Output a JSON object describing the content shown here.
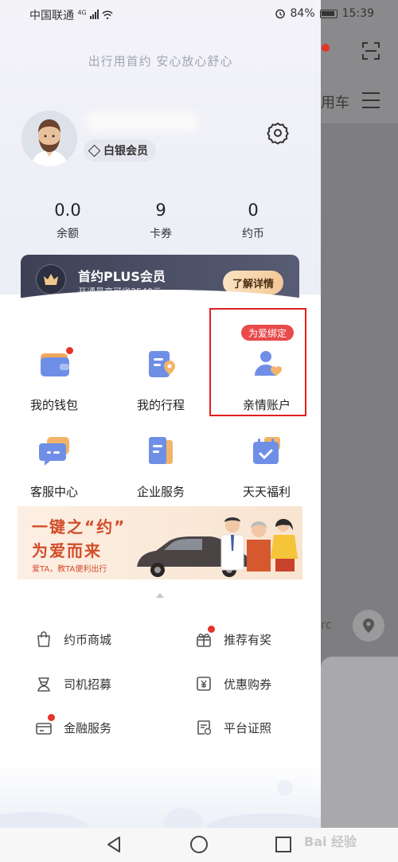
{
  "statusbar": {
    "carrier": "中国联通",
    "network": "4G",
    "battery": "84%",
    "time": "15:39"
  },
  "background": {
    "label_fragment": "用车",
    "map_fragment": "rc"
  },
  "drawer": {
    "slogan": "出行用首约  安心放心舒心",
    "member_level": "白银会员",
    "stats": [
      {
        "value": "0.0",
        "label": "余额"
      },
      {
        "value": "9",
        "label": "卡券"
      },
      {
        "value": "0",
        "label": "约币"
      }
    ],
    "plus": {
      "title": "首约PLUS会员",
      "subtitle": "开通最高可省3540元",
      "button": "了解详情"
    },
    "grid": [
      {
        "label": "我的钱包"
      },
      {
        "label": "我的行程"
      },
      {
        "label": "亲情账户",
        "tag": "为爱绑定"
      },
      {
        "label": "客服中心"
      },
      {
        "label": "企业服务"
      },
      {
        "label": "天天福利"
      }
    ],
    "banner": {
      "line1": "一键之“约”",
      "line2": "为爱而来",
      "line3": "爱TA，教TA便利出行"
    },
    "list": [
      {
        "label": "约币商城"
      },
      {
        "label": "推荐有奖"
      },
      {
        "label": "司机招募"
      },
      {
        "label": "优惠购券"
      },
      {
        "label": "金融服务"
      },
      {
        "label": "平台证照"
      }
    ]
  },
  "watermark": "Bai 经验"
}
